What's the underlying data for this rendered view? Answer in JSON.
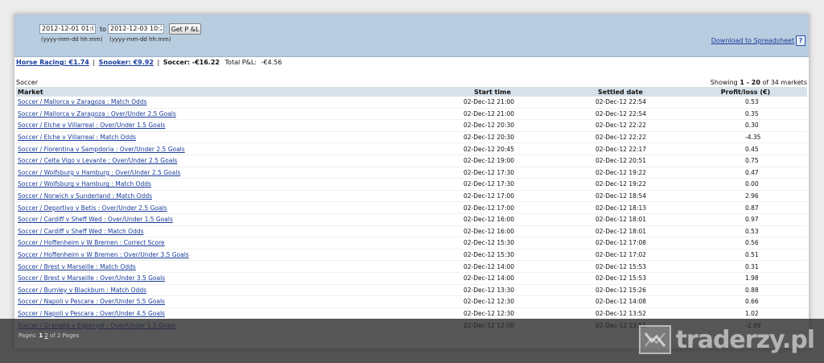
{
  "filter": {
    "from_value": "2012-12-01 01:00",
    "to_label": "to",
    "to_value": "2012-12-03 10:23",
    "from_hint": "(yyyy-mm-dd hh:mm)",
    "to_hint": "(yyyy-mm-dd hh:mm)",
    "button_label": "Get P &L",
    "download_label": "Download to Spreadsheet",
    "help_label": "?"
  },
  "summary": {
    "horse_racing": "Horse Racing: €1.74",
    "separator": "|",
    "snooker": "Snooker: €9.92",
    "soccer": "Soccer: -€16.22",
    "total_label": "Total P&L:",
    "total_value": "-€4.56"
  },
  "section": {
    "sport": "Soccer",
    "showing_prefix": "Showing",
    "showing_range": "1 - 20",
    "showing_of": "of 34 markets"
  },
  "table": {
    "headers": {
      "market": "Market",
      "start": "Start time",
      "settled": "Settled date",
      "pl": "Profit/loss (€)"
    },
    "rows": [
      {
        "market": "Soccer / Mallorca v Zaragoza : Match Odds",
        "start": "02-Dec-12 21:00",
        "settled": "02-Dec-12 22:54",
        "pl": "0.53"
      },
      {
        "market": "Soccer / Mallorca v Zaragoza : Over/Under 2.5 Goals",
        "start": "02-Dec-12 21:00",
        "settled": "02-Dec-12 22:54",
        "pl": "0.35"
      },
      {
        "market": "Soccer / Elche v Villarreal : Over/Under 1.5 Goals",
        "start": "02-Dec-12 20:30",
        "settled": "02-Dec-12 22:22",
        "pl": "0.30"
      },
      {
        "market": "Soccer / Elche v Villarreal : Match Odds",
        "start": "02-Dec-12 20:30",
        "settled": "02-Dec-12 22:22",
        "pl": "-4.35"
      },
      {
        "market": "Soccer / Fiorentina v Sampdoria : Over/Under 2.5 Goals",
        "start": "02-Dec-12 20:45",
        "settled": "02-Dec-12 22:17",
        "pl": "0.45"
      },
      {
        "market": "Soccer / Celta Vigo v Levante : Over/Under 2.5 Goals",
        "start": "02-Dec-12 19:00",
        "settled": "02-Dec-12 20:51",
        "pl": "0.75"
      },
      {
        "market": "Soccer / Wolfsburg v Hamburg : Over/Under 2.5 Goals",
        "start": "02-Dec-12 17:30",
        "settled": "02-Dec-12 19:22",
        "pl": "0.47"
      },
      {
        "market": "Soccer / Wolfsburg v Hamburg : Match Odds",
        "start": "02-Dec-12 17:30",
        "settled": "02-Dec-12 19:22",
        "pl": "0.00"
      },
      {
        "market": "Soccer / Norwich v Sunderland : Match Odds",
        "start": "02-Dec-12 17:00",
        "settled": "02-Dec-12 18:54",
        "pl": "2.96"
      },
      {
        "market": "Soccer / Deportivo v Betis : Over/Under 2.5 Goals",
        "start": "02-Dec-12 17:00",
        "settled": "02-Dec-12 18:13",
        "pl": "0.87"
      },
      {
        "market": "Soccer / Cardiff v Sheff Wed : Over/Under 1.5 Goals",
        "start": "02-Dec-12 16:00",
        "settled": "02-Dec-12 18:01",
        "pl": "0.97"
      },
      {
        "market": "Soccer / Cardiff v Sheff Wed : Match Odds",
        "start": "02-Dec-12 16:00",
        "settled": "02-Dec-12 18:01",
        "pl": "0.53"
      },
      {
        "market": "Soccer / Hoffenheim v W Bremen : Correct Score",
        "start": "02-Dec-12 15:30",
        "settled": "02-Dec-12 17:08",
        "pl": "0.56"
      },
      {
        "market": "Soccer / Hoffenheim v W Bremen : Over/Under 3.5 Goals",
        "start": "02-Dec-12 15:30",
        "settled": "02-Dec-12 17:02",
        "pl": "0.51"
      },
      {
        "market": "Soccer / Brest v Marseille : Match Odds",
        "start": "02-Dec-12 14:00",
        "settled": "02-Dec-12 15:53",
        "pl": "0.31"
      },
      {
        "market": "Soccer / Brest v Marseille : Over/Under 3.5 Goals",
        "start": "02-Dec-12 14:00",
        "settled": "02-Dec-12 15:53",
        "pl": "1.98"
      },
      {
        "market": "Soccer / Burnley v Blackburn : Match Odds",
        "start": "02-Dec-12 13:30",
        "settled": "02-Dec-12 15:26",
        "pl": "0.88"
      },
      {
        "market": "Soccer / Napoli v Pescara : Over/Under 5.5 Goals",
        "start": "02-Dec-12 12:30",
        "settled": "02-Dec-12 14:08",
        "pl": "0.66"
      },
      {
        "market": "Soccer / Napoli v Pescara : Over/Under 4.5 Goals",
        "start": "02-Dec-12 12:30",
        "settled": "02-Dec-12 13:52",
        "pl": "1.02"
      },
      {
        "market": "Soccer / Granada v Espanyol : Over/Under 1.5 Goals",
        "start": "02-Dec-12 12:00",
        "settled": "02-Dec-12 13:51",
        "pl": "-2.99"
      }
    ]
  },
  "pagination": {
    "prefix": "Pages:",
    "current": "1",
    "next": "2",
    "suffix": "of 2 Pages"
  },
  "watermark": {
    "text": "traderzy.pl"
  }
}
